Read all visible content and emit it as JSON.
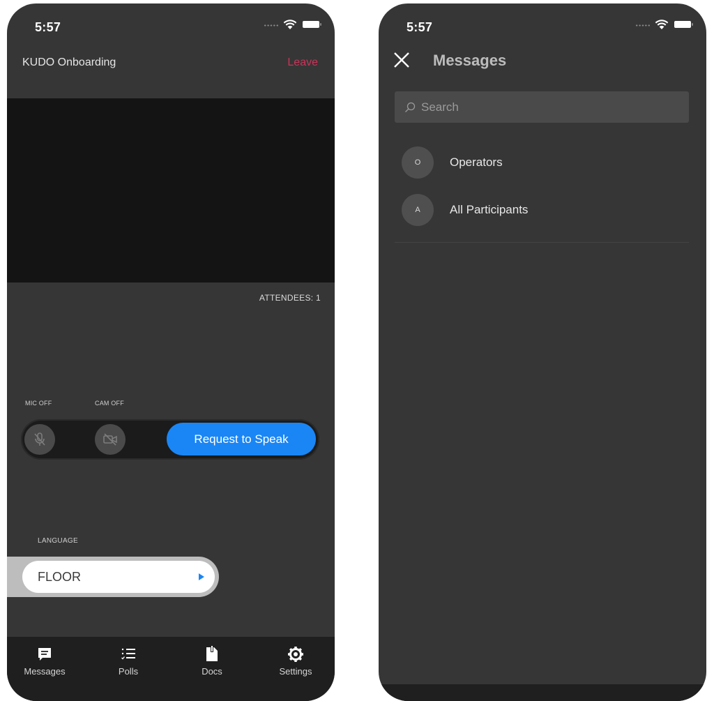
{
  "status_bar": {
    "time": "5:57"
  },
  "meeting": {
    "title": "KUDO Onboarding",
    "leave_label": "Leave",
    "attendees_text": "ATTENDEES: 1",
    "mic_label": "MIC OFF",
    "cam_label": "CAM OFF",
    "request_label": "Request to Speak",
    "language_label": "LANGUAGE",
    "language_value": "FLOOR"
  },
  "tabs": [
    {
      "label": "Messages",
      "icon": "chat-icon"
    },
    {
      "label": "Polls",
      "icon": "polls-icon"
    },
    {
      "label": "Docs",
      "icon": "docs-icon"
    },
    {
      "label": "Settings",
      "icon": "gear-icon"
    }
  ],
  "messages": {
    "title": "Messages",
    "search_placeholder": "Search",
    "contacts": [
      {
        "initial": "O",
        "name": "Operators"
      },
      {
        "initial": "A",
        "name": "All Participants"
      }
    ]
  },
  "colors": {
    "background": "#363636",
    "accent": "#1a86f5",
    "leave": "#c8355a"
  }
}
